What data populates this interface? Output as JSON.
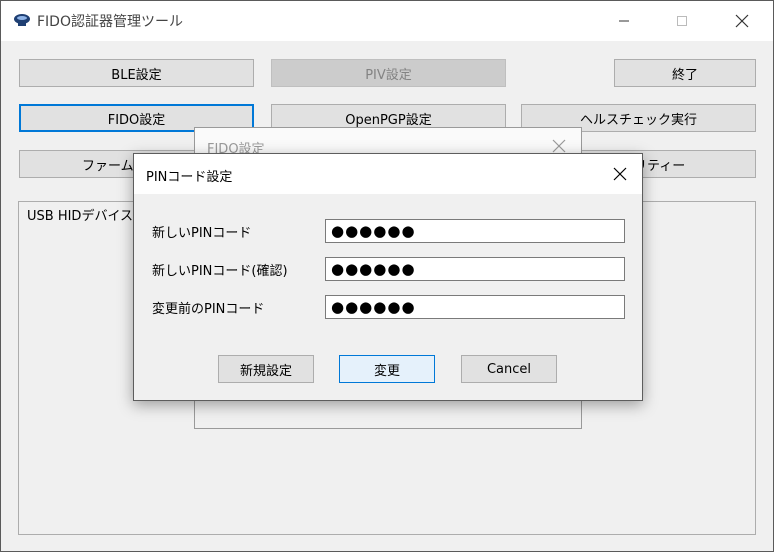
{
  "window": {
    "title": "FIDO認証器管理ツール"
  },
  "toolbar": {
    "ble": "BLE設定",
    "piv": "PIV設定",
    "exit": "終了",
    "fido": "FIDO設定",
    "openpgp": "OpenPGP設定",
    "health": "ヘルスチェック実行",
    "firmware": "ファームウ",
    "utility": "リティー"
  },
  "group": {
    "label": "USB HIDデバイス"
  },
  "fido_dialog": {
    "title": "FIDO設定"
  },
  "pin_dialog": {
    "title": "PINコード設定",
    "new_pin_label": "新しいPINコード",
    "new_pin_value": "●●●●●●",
    "confirm_pin_label": "新しいPINコード(確認)",
    "confirm_pin_value": "●●●●●●",
    "old_pin_label": "変更前のPINコード",
    "old_pin_value": "●●●●●●",
    "new_setting_button": "新規設定",
    "change_button": "変更",
    "cancel_button": "Cancel"
  }
}
